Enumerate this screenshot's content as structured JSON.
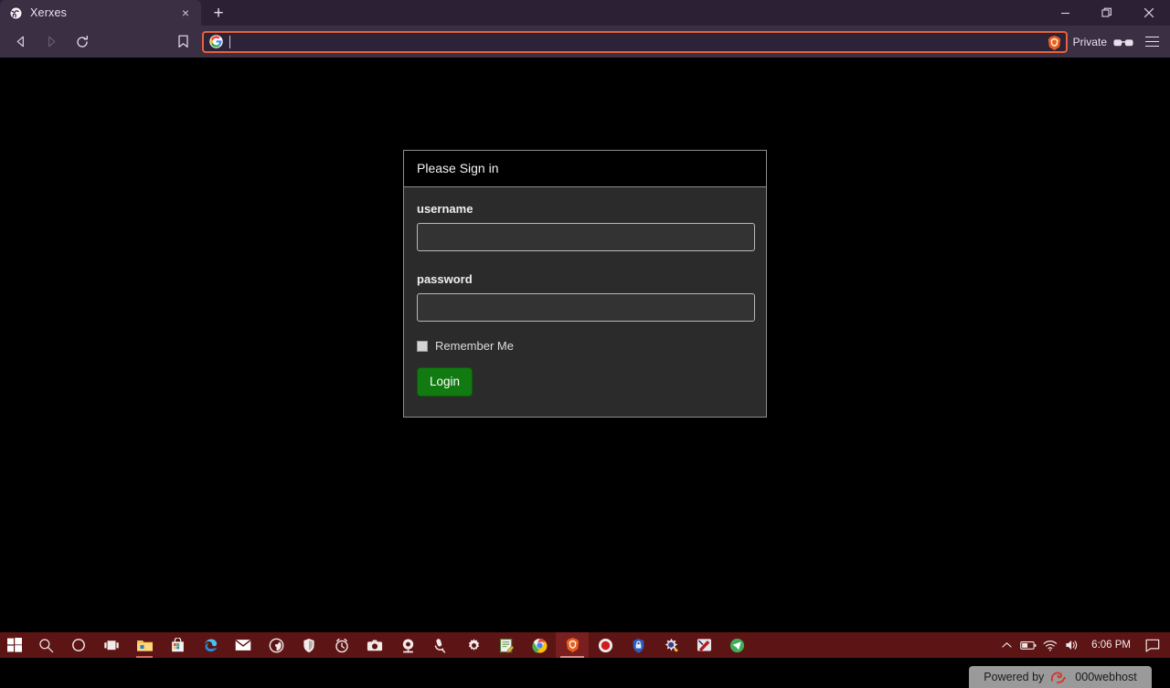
{
  "browser": {
    "name": "Brave",
    "tab": {
      "title": "Xerxes",
      "favicon": "globe-icon",
      "close_label": "×"
    },
    "new_tab_label": "+",
    "window_controls": {
      "minimize": "–",
      "restore": "❐",
      "close": "✕"
    },
    "nav": {
      "back": "back-arrow-icon",
      "forward": "forward-arrow-icon",
      "reload": "reload-icon",
      "bookmark": "bookmark-icon"
    },
    "urlbar": {
      "value": "",
      "placeholder": "",
      "leading_icon": "google-g-icon",
      "trailing_icon": "brave-lion-icon"
    },
    "private_label": "Private",
    "private_icon": "sunglasses-icon",
    "menu_icon": "hamburger-menu-icon",
    "colors": {
      "titlebar": "#2b2034",
      "toolbar": "#3b2f44",
      "active_tab": "#3b2f44",
      "urlbar_focus_border": "#e8603c"
    }
  },
  "page": {
    "background": "#000000",
    "login": {
      "header": "Please Sign in",
      "username": {
        "label": "username",
        "value": "",
        "placeholder": ""
      },
      "password": {
        "label": "password",
        "value": "",
        "placeholder": ""
      },
      "remember": {
        "label": "Remember Me",
        "checked": false
      },
      "submit": {
        "label": "Login",
        "color": "#117a11"
      },
      "panel_bg": "#2b2b2b",
      "panel_border": "#8e8e8e"
    },
    "badge": {
      "prefix": "Powered by",
      "brand": "000webhost",
      "logo": "000webhost-swirl-icon",
      "bg": "#9a9a9a",
      "accent": "#d8322a"
    }
  },
  "taskbar": {
    "bg": "#5d1414",
    "items": [
      {
        "name": "start-button",
        "icon": "windows-logo-icon"
      },
      {
        "name": "search-button",
        "icon": "magnifier-icon"
      },
      {
        "name": "cortana-button",
        "icon": "circle-icon"
      },
      {
        "name": "task-view-button",
        "icon": "task-view-icon"
      },
      {
        "name": "file-explorer-button",
        "icon": "folder-icon",
        "running": true
      },
      {
        "name": "microsoft-store-button",
        "icon": "store-bag-icon"
      },
      {
        "name": "edge-button",
        "icon": "edge-icon"
      },
      {
        "name": "mail-button",
        "icon": "envelope-icon"
      },
      {
        "name": "media-player-button",
        "icon": "disc-icon"
      },
      {
        "name": "security-button",
        "icon": "shield-icon"
      },
      {
        "name": "alarms-button",
        "icon": "alarm-clock-icon"
      },
      {
        "name": "camera-button",
        "icon": "camera-icon"
      },
      {
        "name": "webcam-button",
        "icon": "webcam-icon"
      },
      {
        "name": "voice-recorder-button",
        "icon": "microphone-icon"
      },
      {
        "name": "settings-button",
        "icon": "gear-icon"
      },
      {
        "name": "notepad-button",
        "icon": "notepad-icon"
      },
      {
        "name": "chrome-button",
        "icon": "chrome-icon"
      },
      {
        "name": "brave-button",
        "icon": "brave-lion-icon",
        "active": true
      },
      {
        "name": "record-button",
        "icon": "record-dot-icon"
      },
      {
        "name": "vpn-button",
        "icon": "blue-shield-icon"
      },
      {
        "name": "sd-tool-button",
        "icon": "sd-burst-icon"
      },
      {
        "name": "paint-button",
        "icon": "paint-icon"
      },
      {
        "name": "telegram-button",
        "icon": "paper-plane-icon"
      }
    ],
    "tray": {
      "overflow_icon": "chevron-up-icon",
      "battery_icon": "battery-icon",
      "network_icon": "wifi-icon",
      "volume_icon": "speaker-icon",
      "clock": "6:06 PM",
      "notification_icon": "speech-bubble-icon"
    }
  }
}
